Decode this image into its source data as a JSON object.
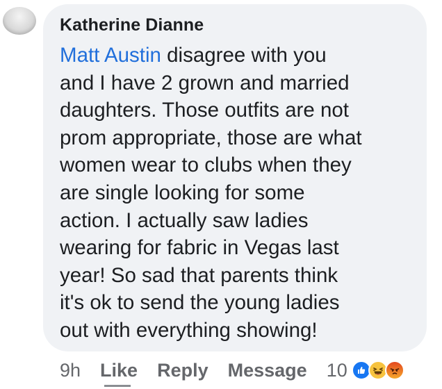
{
  "comment": {
    "author": "Katherine Dianne",
    "mention": "Matt Austin",
    "lines": [
      " disagree with you",
      "and I have 2 grown and married",
      "daughters. Those outfits are not",
      "prom appropriate, those are what",
      "women wear to clubs when they",
      "are single looking for some",
      "action. I actually saw ladies",
      "wearing for fabric in Vegas last",
      "year! So sad that parents think",
      "it's ok to send the young ladies",
      "out with everything showing!"
    ]
  },
  "actions": {
    "time": "9h",
    "like_label": "Like",
    "reply_label": "Reply",
    "message_label": "Message",
    "reaction_count": "10"
  },
  "reactions": [
    "like-icon",
    "haha-icon",
    "angry-icon"
  ],
  "colors": {
    "bubble": "#f0f2f5",
    "mention": "#216fdb",
    "text": "#1c1e21",
    "meta": "#65676b",
    "like": "#1877f2",
    "haha": "#f7c33f",
    "angry": "#e9710f"
  }
}
